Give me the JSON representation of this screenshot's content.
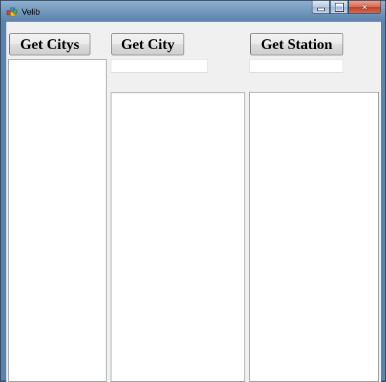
{
  "window": {
    "title": "Velib",
    "minimize_glyph": "",
    "maximize_glyph": "",
    "close_glyph": "✕"
  },
  "buttons": {
    "get_citys": "Get Citys",
    "get_city": "Get City",
    "get_station": "Get Station"
  },
  "inputs": {
    "city_value": "",
    "station_value": ""
  },
  "colors": {
    "client_background": "#f0f0f0",
    "close_button": "#c24126"
  }
}
